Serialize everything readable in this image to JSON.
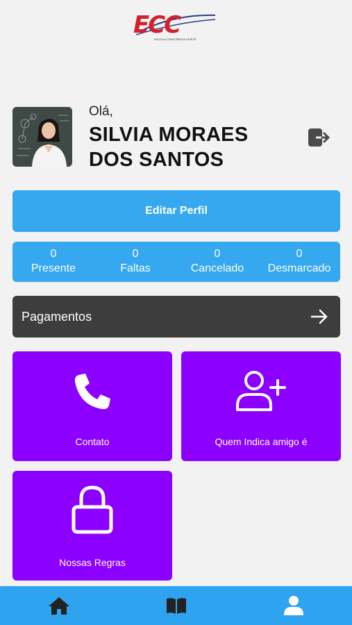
{
  "header": {
    "logo_text": "ECC",
    "logo_subtext": "ESCOLA CONSCIÊNCIA CRISTÃ"
  },
  "profile": {
    "greeting": "Olá,",
    "name": "SILVIA MORAES DOS SANTOS"
  },
  "actions": {
    "edit_profile": "Editar Perfil",
    "payments": "Pagamentos"
  },
  "stats": [
    {
      "value": "0",
      "label": "Presente"
    },
    {
      "value": "0",
      "label": "Faltas"
    },
    {
      "value": "0",
      "label": "Cancelado"
    },
    {
      "value": "0",
      "label": "Desmarcado"
    }
  ],
  "tiles": [
    {
      "label": "Contato",
      "icon": "phone-icon"
    },
    {
      "label": "Quem Indica amigo é",
      "icon": "add-user-icon"
    },
    {
      "label": "Nossas Regras",
      "icon": "lock-icon"
    }
  ],
  "nav": [
    {
      "icon": "home-icon"
    },
    {
      "icon": "book-icon"
    },
    {
      "icon": "user-icon"
    }
  ],
  "colors": {
    "primary": "#35a8ef",
    "tile": "#8c00ff",
    "dark": "#3d3d3d",
    "logo": "#d4202a"
  }
}
